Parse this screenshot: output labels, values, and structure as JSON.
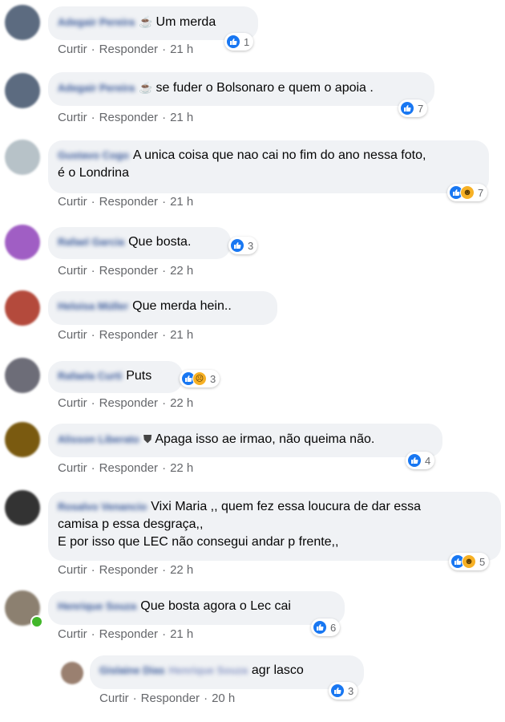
{
  "actions": {
    "like": "Curtir",
    "reply": "Responder",
    "sep": "·"
  },
  "comments": [
    {
      "author": "Adegair Pereira",
      "text": "Um merda",
      "prefix": "☕",
      "time": "21 h",
      "reactions": "1",
      "avatar": "#5c6b80"
    },
    {
      "author": "Adegair Pereira",
      "text": "se fuder o Bolsonaro e quem o apoia .",
      "prefix": "☕",
      "time": "21 h",
      "reactions": "7",
      "avatar": "#5c6b80"
    },
    {
      "author": "Gustavo Cogo",
      "text": "A unica coisa que nao cai no fim do ano nessa foto,",
      "text2": "é o Londrina",
      "time": "21 h",
      "reactions": "7",
      "avatar": "#b7c2c8"
    },
    {
      "author": "Rafael Garcia",
      "text": "Que bosta.",
      "time": "22 h",
      "reactions": "3",
      "avatar": "#a05ec4"
    },
    {
      "author": "Heloisa Müller",
      "text": "Que merda hein..",
      "time": "21 h",
      "avatar": "#b44a3c"
    },
    {
      "author": "Rafaela Curti",
      "text": "Puts",
      "time": "22 h",
      "reactions": "3",
      "avatar": "#6d6d78"
    },
    {
      "author": "Alisson Liberato",
      "text": "Apaga isso ae irmao, não queima não.",
      "time": "22 h",
      "reactions": "4",
      "avatar": "#7a5a10"
    },
    {
      "author": "Rosalvo Venancio",
      "text": "Vixi Maria ,, quem fez essa loucura de dar essa",
      "text2": "camisa p essa desgraça,,",
      "text3": "E por isso que LEC não consegui andar p frente,,",
      "time": "22 h",
      "reactions": "5",
      "avatar": "#333333"
    },
    {
      "author": "Henrique Souza",
      "text": "Que bosta agora o Lec cai",
      "time": "21 h",
      "reactions": "6",
      "avatar": "#8c8070"
    },
    {
      "author": "Gislaine Dias",
      "mention": "Henrique Souza",
      "text": "agr lasco",
      "time": "20 h",
      "reactions": "3",
      "avatar": "#9a8070"
    }
  ]
}
